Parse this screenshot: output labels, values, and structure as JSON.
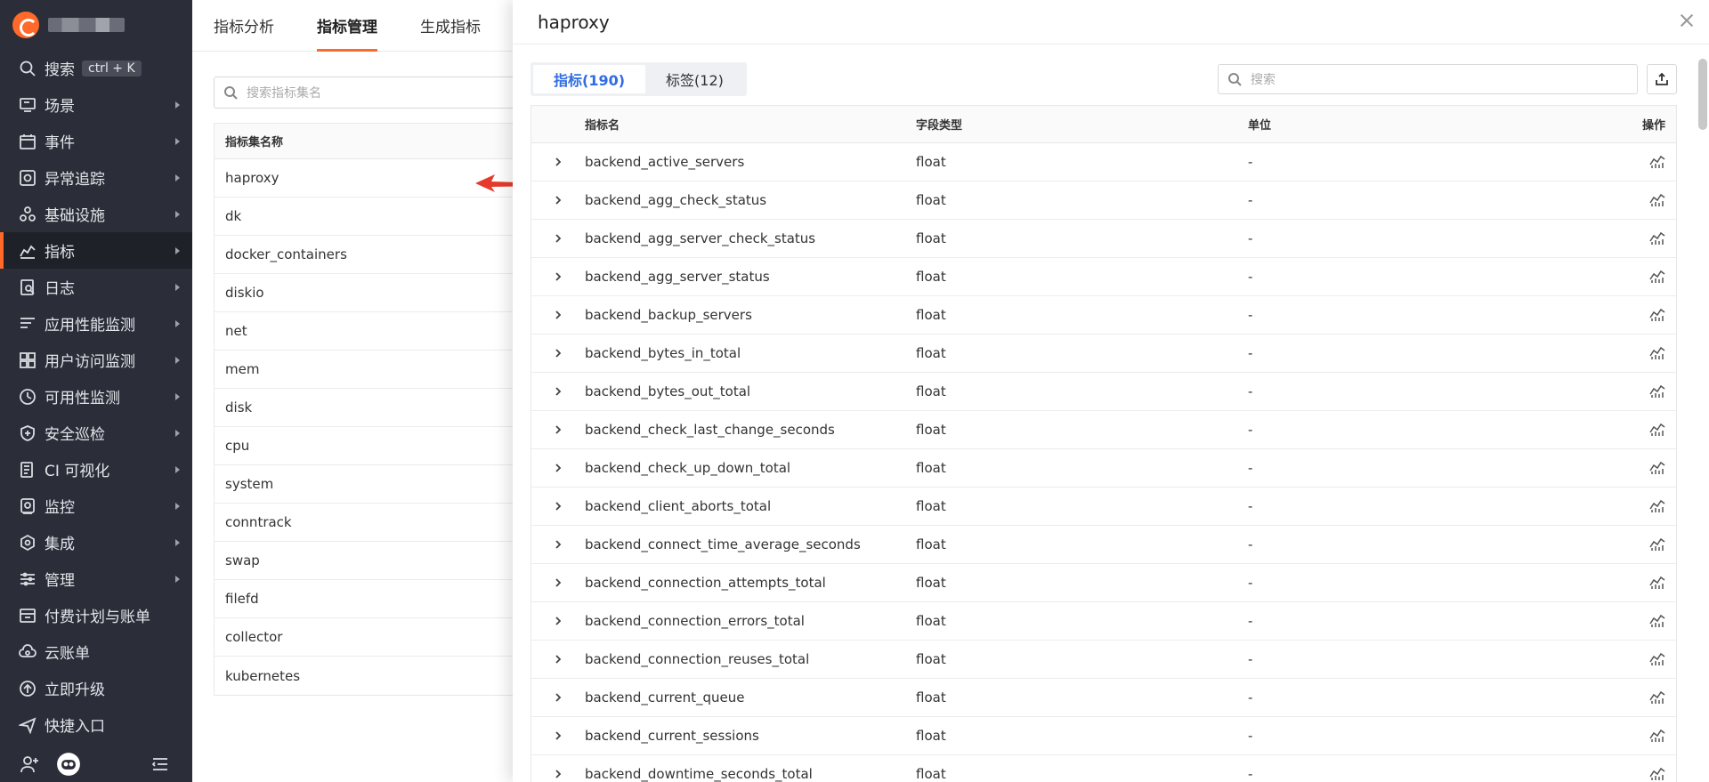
{
  "sidebar": {
    "search_label": "搜索",
    "search_shortcut": "ctrl + K",
    "items": [
      {
        "label": "场景",
        "icon": "monitor-icon"
      },
      {
        "label": "事件",
        "icon": "calendar-icon"
      },
      {
        "label": "异常追踪",
        "icon": "bug-track-icon"
      },
      {
        "label": "基础设施",
        "icon": "infrastructure-icon"
      },
      {
        "label": "指标",
        "icon": "metrics-icon"
      },
      {
        "label": "日志",
        "icon": "log-icon"
      },
      {
        "label": "应用性能监测",
        "icon": "apm-icon"
      },
      {
        "label": "用户访问监测",
        "icon": "rum-icon"
      },
      {
        "label": "可用性监测",
        "icon": "availability-icon"
      },
      {
        "label": "安全巡检",
        "icon": "shield-icon"
      },
      {
        "label": "CI 可视化",
        "icon": "ci-icon"
      },
      {
        "label": "监控",
        "icon": "monitor-alarm-icon"
      },
      {
        "label": "集成",
        "icon": "integration-icon"
      },
      {
        "label": "管理",
        "icon": "settings-icon"
      },
      {
        "label": "付费计划与账单",
        "icon": "billing-icon"
      },
      {
        "label": "云账单",
        "icon": "cloud-bill-icon"
      },
      {
        "label": "立即升级",
        "icon": "upgrade-icon"
      },
      {
        "label": "快捷入口",
        "icon": "send-icon"
      }
    ],
    "active_item": "指标"
  },
  "main": {
    "tabs": [
      "指标分析",
      "指标管理",
      "生成指标"
    ],
    "active_tab": "指标管理",
    "search_placeholder": "搜索指标集名",
    "set_table_header": "指标集名称",
    "sets": [
      "haproxy",
      "dk",
      "docker_containers",
      "diskio",
      "net",
      "mem",
      "disk",
      "cpu",
      "system",
      "conntrack",
      "swap",
      "filefd",
      "collector",
      "kubernetes"
    ]
  },
  "drawer": {
    "title": "haproxy",
    "segments": [
      "指标(190)",
      "标签(12)"
    ],
    "active_segment": "指标(190)",
    "search_placeholder": "搜索",
    "columns": [
      "指标名",
      "字段类型",
      "单位",
      "操作"
    ],
    "rows": [
      {
        "name": "backend_active_servers",
        "type": "float",
        "unit": "-"
      },
      {
        "name": "backend_agg_check_status",
        "type": "float",
        "unit": "-"
      },
      {
        "name": "backend_agg_server_check_status",
        "type": "float",
        "unit": "-"
      },
      {
        "name": "backend_agg_server_status",
        "type": "float",
        "unit": "-"
      },
      {
        "name": "backend_backup_servers",
        "type": "float",
        "unit": "-"
      },
      {
        "name": "backend_bytes_in_total",
        "type": "float",
        "unit": "-"
      },
      {
        "name": "backend_bytes_out_total",
        "type": "float",
        "unit": "-"
      },
      {
        "name": "backend_check_last_change_seconds",
        "type": "float",
        "unit": "-"
      },
      {
        "name": "backend_check_up_down_total",
        "type": "float",
        "unit": "-"
      },
      {
        "name": "backend_client_aborts_total",
        "type": "float",
        "unit": "-"
      },
      {
        "name": "backend_connect_time_average_seconds",
        "type": "float",
        "unit": "-"
      },
      {
        "name": "backend_connection_attempts_total",
        "type": "float",
        "unit": "-"
      },
      {
        "name": "backend_connection_errors_total",
        "type": "float",
        "unit": "-"
      },
      {
        "name": "backend_connection_reuses_total",
        "type": "float",
        "unit": "-"
      },
      {
        "name": "backend_current_queue",
        "type": "float",
        "unit": "-"
      },
      {
        "name": "backend_current_sessions",
        "type": "float",
        "unit": "-"
      },
      {
        "name": "backend_downtime_seconds_total",
        "type": "float",
        "unit": "-"
      }
    ]
  },
  "colors": {
    "sidebar_bg": "#2b2e38",
    "accent": "#ff6a2a",
    "segment_active": "#2f6de1",
    "annotation_arrow": "#e53b2c"
  }
}
